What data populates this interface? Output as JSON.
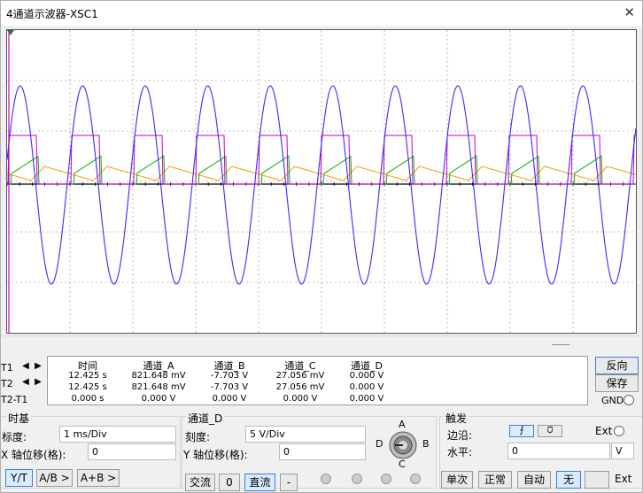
{
  "window": {
    "title": "4通道示波器-XSC1",
    "close_glyph": "✕"
  },
  "readout": {
    "row_labels": [
      "T1",
      "T2",
      "T2-T1"
    ],
    "headers": [
      "时间",
      "通道_A",
      "通道_B",
      "通道_C",
      "通道_D"
    ],
    "rows": [
      [
        "12.425 s",
        "821.648 mV",
        "-7.703 V",
        "27.056 mV",
        "0.000 V"
      ],
      [
        "12.425 s",
        "821.648 mV",
        "-7.703 V",
        "27.056 mV",
        "0.000 V"
      ],
      [
        "0.000 s",
        "0.000 V",
        "0.000 V",
        "0.000 V",
        "0.000 V"
      ]
    ]
  },
  "side_buttons": {
    "reverse": "反向",
    "save": "保存",
    "gnd": "GND"
  },
  "timebase": {
    "title": "时基",
    "scale_label": "标度:",
    "scale_value": "1 ms/Div",
    "xpos_label": "X 轴位移(格):",
    "xpos_value": "0",
    "modes": [
      "Y/T",
      "A/B >",
      "A+B >"
    ]
  },
  "channel": {
    "title": "通道_D",
    "scale_label": "刻度:",
    "scale_value": "5  V/Div",
    "ypos_label": "Y 轴位移(格):",
    "ypos_value": "0",
    "coupling": [
      "交流",
      "0",
      "直流",
      "-"
    ],
    "knob_labels": [
      "A",
      "B",
      "C",
      "D"
    ]
  },
  "trigger": {
    "title": "触发",
    "edge_label": "边沿:",
    "ext_label": "Ext",
    "level_label": "水平:",
    "level_value": "0",
    "level_unit": "V",
    "modes": [
      "单次",
      "正常",
      "自动",
      "无",
      "Ext"
    ]
  },
  "colors": {
    "channel_a": "#00b400",
    "channel_b": "#ff9900",
    "channel_c": "#3c28ff",
    "channel_d": "#c800c8",
    "grid": "#888888",
    "accent": "#3b7fd4"
  }
}
